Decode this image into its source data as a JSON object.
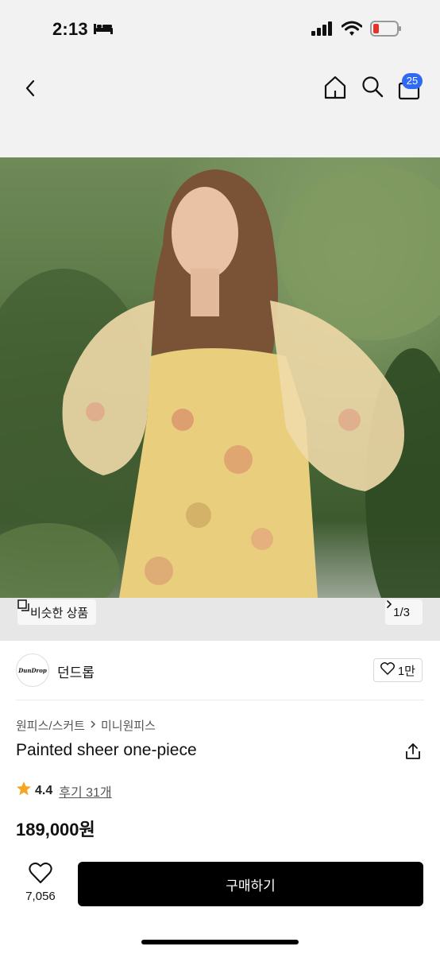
{
  "status_bar": {
    "time": "2:13"
  },
  "header": {
    "cart_count": "25"
  },
  "hero": {
    "similar_label": "비슷한 상품",
    "page_indicator": "1/3"
  },
  "shop": {
    "logo_text": "DunDrop",
    "name": "던드롭",
    "favorite_count": "1만"
  },
  "product": {
    "breadcrumb": [
      "원피스/스커트",
      "미니원피스"
    ],
    "title": "Painted sheer one-piece",
    "rating": "4.4",
    "review_label": "후기 31개",
    "price": "189,000원"
  },
  "bottom_bar": {
    "like_count": "7,056",
    "buy_label": "구매하기"
  },
  "colors": {
    "accent": "#2f6bf2",
    "buy_button": "#000000",
    "star": "#f5a623"
  }
}
